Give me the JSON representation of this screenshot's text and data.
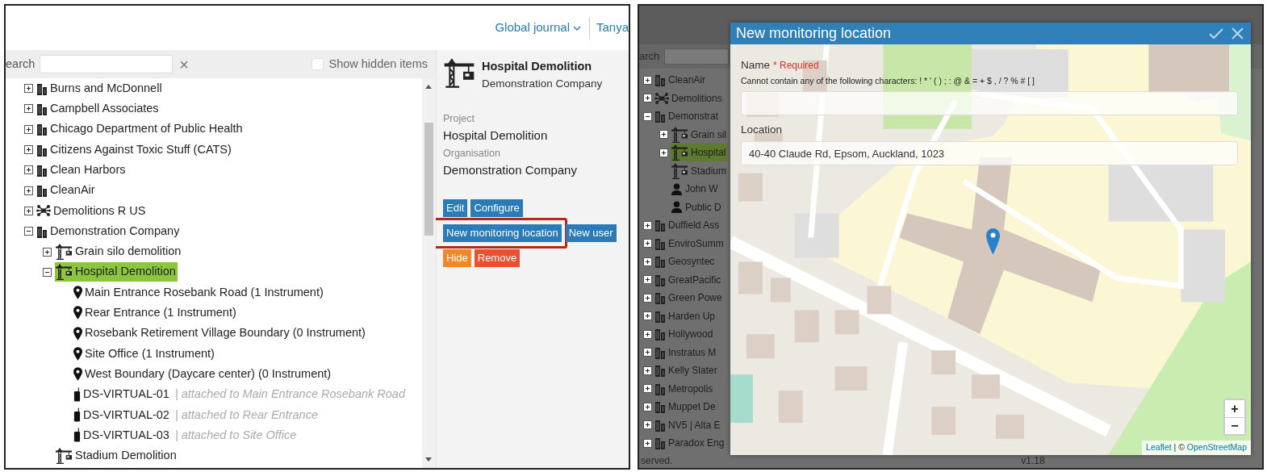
{
  "left_window": {
    "header": {
      "journal_menu": "Global journal",
      "user": "Tanya"
    },
    "search": {
      "label": "earch",
      "clear": "×"
    },
    "show_hidden": {
      "label": "Show hidden items",
      "checked": false
    },
    "tree": [
      {
        "label": "Burns and McDonnell",
        "kind": "organisation",
        "expanded": false,
        "selected": false
      },
      {
        "label": "Campbell Associates",
        "kind": "organisation",
        "expanded": false,
        "selected": false
      },
      {
        "label": "Chicago Department of Public Health",
        "kind": "organisation",
        "expanded": false,
        "selected": false
      },
      {
        "label": "Citizens Against Toxic Stuff (CATS)",
        "kind": "organisation",
        "expanded": false,
        "selected": false
      },
      {
        "label": "Clean Harbors",
        "kind": "organisation",
        "expanded": false,
        "selected": false
      },
      {
        "label": "CleanAir",
        "kind": "organisation",
        "expanded": false,
        "selected": false
      },
      {
        "label": "Demolitions R US",
        "kind": "network",
        "expanded": false,
        "selected": false
      },
      {
        "label": "Demonstration Company",
        "kind": "organisation",
        "expanded": true,
        "selected": false,
        "children": [
          {
            "label": "Grain silo demolition",
            "kind": "project",
            "expanded": false,
            "selected": false
          },
          {
            "label": "Hospital Demolition",
            "kind": "project",
            "expanded": true,
            "selected": true,
            "children": [
              {
                "label": "Main Entrance Rosebank Road (1 Instrument)",
                "kind": "location",
                "selected": false
              },
              {
                "label": "Rear Entrance (1 Instrument)",
                "kind": "location",
                "selected": false
              },
              {
                "label": "Rosebank Retirement Village Boundary (0 Instrument)",
                "kind": "location",
                "selected": false
              },
              {
                "label": "Site Office (1 Instrument)",
                "kind": "location",
                "selected": false
              },
              {
                "label": "West Boundary (Daycare center) (0 Instrument)",
                "kind": "location",
                "selected": false
              },
              {
                "label": "DS-VIRTUAL-01",
                "kind": "instrument",
                "selected": false,
                "note": "| attached to Main Entrance Rosebank Road"
              },
              {
                "label": "DS-VIRTUAL-02",
                "kind": "instrument",
                "selected": false,
                "note": "| attached to Rear Entrance"
              },
              {
                "label": "DS-VIRTUAL-03",
                "kind": "instrument",
                "selected": false,
                "note": "| attached to Site Office"
              }
            ]
          },
          {
            "label": "Stadium Demolition",
            "kind": "project",
            "selected": false
          }
        ]
      }
    ],
    "details": {
      "title": "Hospital Demolition",
      "subtitle": "Demonstration Company",
      "fields": [
        {
          "label": "Project",
          "value": "Hospital Demolition"
        },
        {
          "label": "Organisation",
          "value": "Demonstration Company"
        }
      ],
      "button_rows": [
        [
          {
            "label": "Edit",
            "kind": "primary",
            "highlighted": false
          },
          {
            "label": "Configure",
            "kind": "primary",
            "highlighted": false
          }
        ],
        [
          {
            "label": "New monitoring location",
            "kind": "primary",
            "highlighted": true
          },
          {
            "label": "New user",
            "kind": "primary",
            "highlighted": false
          }
        ],
        [
          {
            "label": "Hide",
            "kind": "warning",
            "highlighted": false
          },
          {
            "label": "Remove",
            "kind": "danger",
            "highlighted": false
          }
        ]
      ]
    }
  },
  "right_window": {
    "background": {
      "search_label": "arch",
      "tree": [
        {
          "label": "CleanAir",
          "kind": "organisation",
          "expanded": false,
          "selected": false
        },
        {
          "label": "Demolitions",
          "kind": "network",
          "expanded": false,
          "selected": false
        },
        {
          "label": "Demonstrat",
          "kind": "organisation",
          "expanded": true,
          "selected": false,
          "children": [
            {
              "label": "Grain sil",
              "kind": "project",
              "expanded": false,
              "selected": false
            },
            {
              "label": "Hospital",
              "kind": "project",
              "expanded": false,
              "selected": true
            },
            {
              "label": "Stadium",
              "kind": "project",
              "selected": false
            },
            {
              "label": "John W",
              "kind": "user",
              "selected": false
            },
            {
              "label": "Public D",
              "kind": "user",
              "selected": false
            }
          ]
        },
        {
          "label": "Duffield Ass",
          "kind": "organisation",
          "expanded": false,
          "selected": false
        },
        {
          "label": "EnviroSumm",
          "kind": "organisation",
          "expanded": false,
          "selected": false
        },
        {
          "label": "Geosyntec",
          "kind": "organisation",
          "expanded": false,
          "selected": false
        },
        {
          "label": "GreatPacific",
          "kind": "organisation",
          "expanded": false,
          "selected": false
        },
        {
          "label": "Green Powe",
          "kind": "organisation",
          "expanded": false,
          "selected": false
        },
        {
          "label": "Harden Up",
          "kind": "organisation",
          "expanded": false,
          "selected": false
        },
        {
          "label": "Hollywood",
          "kind": "organisation",
          "expanded": false,
          "selected": false
        },
        {
          "label": "Instratus M",
          "kind": "organisation",
          "expanded": false,
          "selected": false
        },
        {
          "label": "Kelly Slater",
          "kind": "organisation",
          "expanded": false,
          "selected": false
        },
        {
          "label": "Metropolis",
          "kind": "organisation",
          "expanded": false,
          "selected": false
        },
        {
          "label": "Muppet De",
          "kind": "organisation",
          "expanded": false,
          "selected": false
        },
        {
          "label": "NV5 | Alta E",
          "kind": "organisation",
          "expanded": false,
          "selected": false
        },
        {
          "label": "Paradox Eng",
          "kind": "organisation",
          "expanded": false,
          "selected": false
        }
      ],
      "footer": "served.",
      "version": "v1.18"
    },
    "dialog": {
      "title": "New monitoring location",
      "name": {
        "label": "Name",
        "required": "* Required",
        "hint": "Cannot contain any of the following characters: ! * ' ( ) ; : @ & = + $ , / ? % # [ ]"
      },
      "location": {
        "label": "Location",
        "value": "40-40 Claude Rd, Epsom, Auckland, 1023"
      },
      "map": {
        "zoom_in": "+",
        "zoom_out": "−",
        "attribution": [
          {
            "text": "Leaflet",
            "link": true
          },
          {
            "text": " | © ",
            "link": false
          },
          {
            "text": "OpenStreetMap",
            "link": true
          }
        ]
      }
    }
  }
}
